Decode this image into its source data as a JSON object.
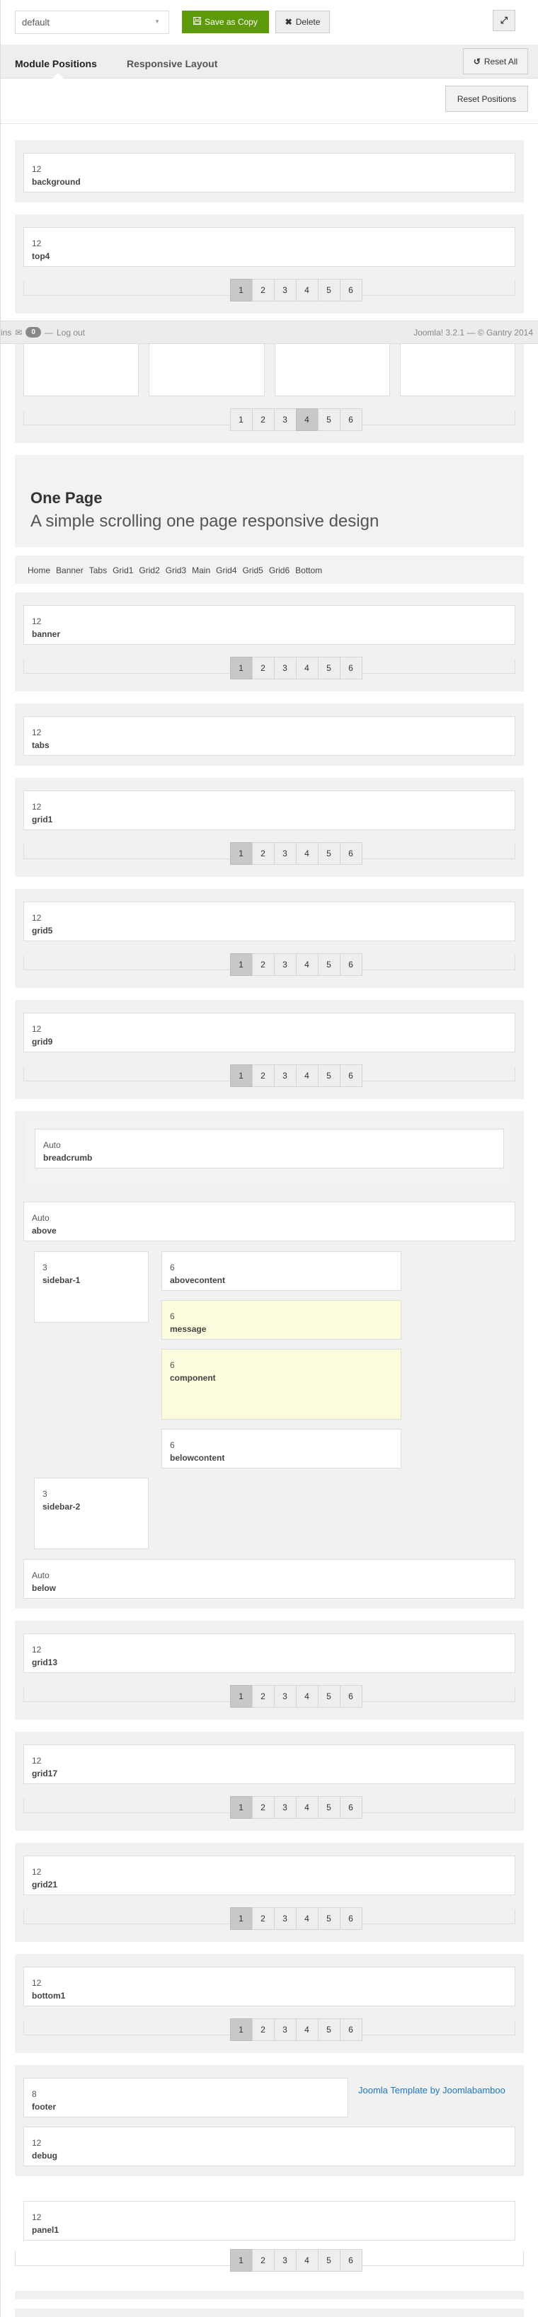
{
  "toolbar": {
    "layout_select_value": "default",
    "save_copy_label": "Save as Copy",
    "delete_label": "Delete"
  },
  "tabs": [
    {
      "label": "Module Positions",
      "active": true
    },
    {
      "label": "Responsive Layout",
      "active": false
    }
  ],
  "reset_all_label": "Reset All",
  "reset_positions_label": "Reset Positions",
  "status_bar": {
    "left_partial": "ins",
    "messages_count": "0",
    "logout_label": "Log out",
    "right_text": "Joomla! 3.2.1  —  © Gantry 2014"
  },
  "pager_options": [
    "1",
    "2",
    "3",
    "4",
    "5",
    "6"
  ],
  "sections_top": [
    {
      "size": "12",
      "name": "background",
      "pager": null
    },
    {
      "size": "12",
      "name": "top4",
      "pager": "1"
    }
  ],
  "four_col_section": {
    "pager": "4"
  },
  "hero": {
    "title": "One Page",
    "subtitle": "A simple scrolling one page responsive design"
  },
  "menu": [
    "Home",
    "Banner",
    "Tabs",
    "Grid1",
    "Grid2",
    "Grid3",
    "Main",
    "Grid4",
    "Grid5",
    "Grid6",
    "Bottom"
  ],
  "sections_mid": [
    {
      "size": "12",
      "name": "banner",
      "pager": "1"
    },
    {
      "size": "12",
      "name": "tabs",
      "pager": null
    },
    {
      "size": "12",
      "name": "grid1",
      "pager": "1"
    },
    {
      "size": "12",
      "name": "grid5",
      "pager": "1"
    },
    {
      "size": "12",
      "name": "grid9",
      "pager": "1"
    }
  ],
  "mainbody": {
    "breadcrumb": {
      "size": "Auto",
      "name": "breadcrumb"
    },
    "above": {
      "size": "Auto",
      "name": "above"
    },
    "sidebar1": {
      "size": "3",
      "name": "sidebar-1"
    },
    "abovecontent": {
      "size": "6",
      "name": "abovecontent"
    },
    "message": {
      "size": "6",
      "name": "message"
    },
    "component": {
      "size": "6",
      "name": "component"
    },
    "belowcontent": {
      "size": "6",
      "name": "belowcontent"
    },
    "sidebar2": {
      "size": "3",
      "name": "sidebar-2"
    },
    "below": {
      "size": "Auto",
      "name": "below"
    }
  },
  "sections_bottom": [
    {
      "size": "12",
      "name": "grid13",
      "pager": "1"
    },
    {
      "size": "12",
      "name": "grid17",
      "pager": "1"
    },
    {
      "size": "12",
      "name": "grid21",
      "pager": "1"
    },
    {
      "size": "12",
      "name": "bottom1",
      "pager": "1"
    }
  ],
  "footer_section": {
    "footer": {
      "size": "8",
      "name": "footer"
    },
    "link_text": "Joomla Template by Joomlabamboo",
    "debug": {
      "size": "12",
      "name": "debug"
    }
  },
  "panel": {
    "size": "12",
    "name": "panel1",
    "pager": "1"
  },
  "colors": {
    "accent_green": "#5c9a09",
    "link_blue": "#1d76c2",
    "highlight_yellow": "#fdfcde"
  }
}
